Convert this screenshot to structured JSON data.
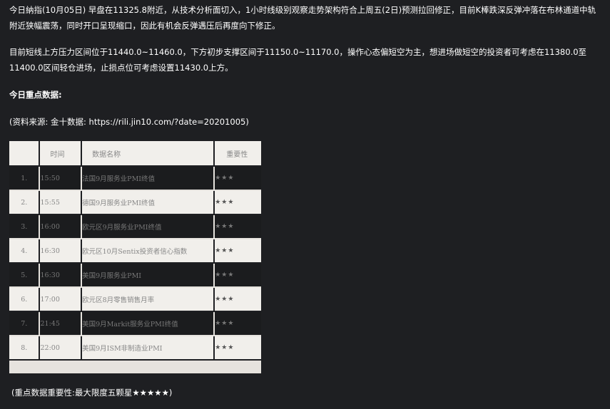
{
  "paragraphs": {
    "p1": "今日納指(10月05日) 早盘在11325.8附近，从技术分析面切入，1小时线级别观察走势架构符合上周五(2日)预测拉回修正，目前K棒跌深反弹冲落在布林通道中轨附近狭幅震荡，同时开口呈现缩口，因此有机会反弹遇压后再度向下修正。",
    "p2": "目前短线上方压力区间位于11440.0~11460.0，下方初步支撑区间于11150.0~11170.0，操作心态偏短空为主，想进场做短空的投资者可考虑在11380.0至11400.0区间轻仓进场，止损点位可考虑设置11430.0上方。",
    "p3": "今日重点数据:",
    "p4": "(资料来源: 金十数据: https://rili.jin10.com/?date=20201005)",
    "p5": "(重点数据重要性:最大限度五颗星★★★★★)"
  },
  "table": {
    "headers": [
      "",
      "时间",
      "数据名称",
      "重要性"
    ],
    "rows": [
      {
        "idx": "1.",
        "time": "15:50",
        "name": "法国9月服务业PMI终值",
        "importance": "★★★",
        "style": "dark"
      },
      {
        "idx": "2.",
        "time": "15:55",
        "name": "德国9月服务业PMI终值",
        "importance": "★★★",
        "style": "light"
      },
      {
        "idx": "3.",
        "time": "16:00",
        "name": "欧元区9月服务业PMI终值",
        "importance": "★★★",
        "style": "dark"
      },
      {
        "idx": "4.",
        "time": "16:30",
        "name": "欧元区10月Sentix投资者信心指数",
        "importance": "★★★",
        "style": "light"
      },
      {
        "idx": "5.",
        "time": "16:30",
        "name": "美国9月服务业PMI",
        "importance": "★★★",
        "style": "dark"
      },
      {
        "idx": "6.",
        "time": "17:00",
        "name": "欧元区8月零售销售月率",
        "importance": "★★★",
        "style": "light"
      },
      {
        "idx": "7.",
        "time": "21:45",
        "name": "美国9月Markit服务业PMI终值",
        "importance": "★★★",
        "style": "dark"
      },
      {
        "idx": "8.",
        "time": "22:00",
        "name": "美国9月ISM非制造业PMI",
        "importance": "★★★",
        "style": "light"
      }
    ]
  }
}
